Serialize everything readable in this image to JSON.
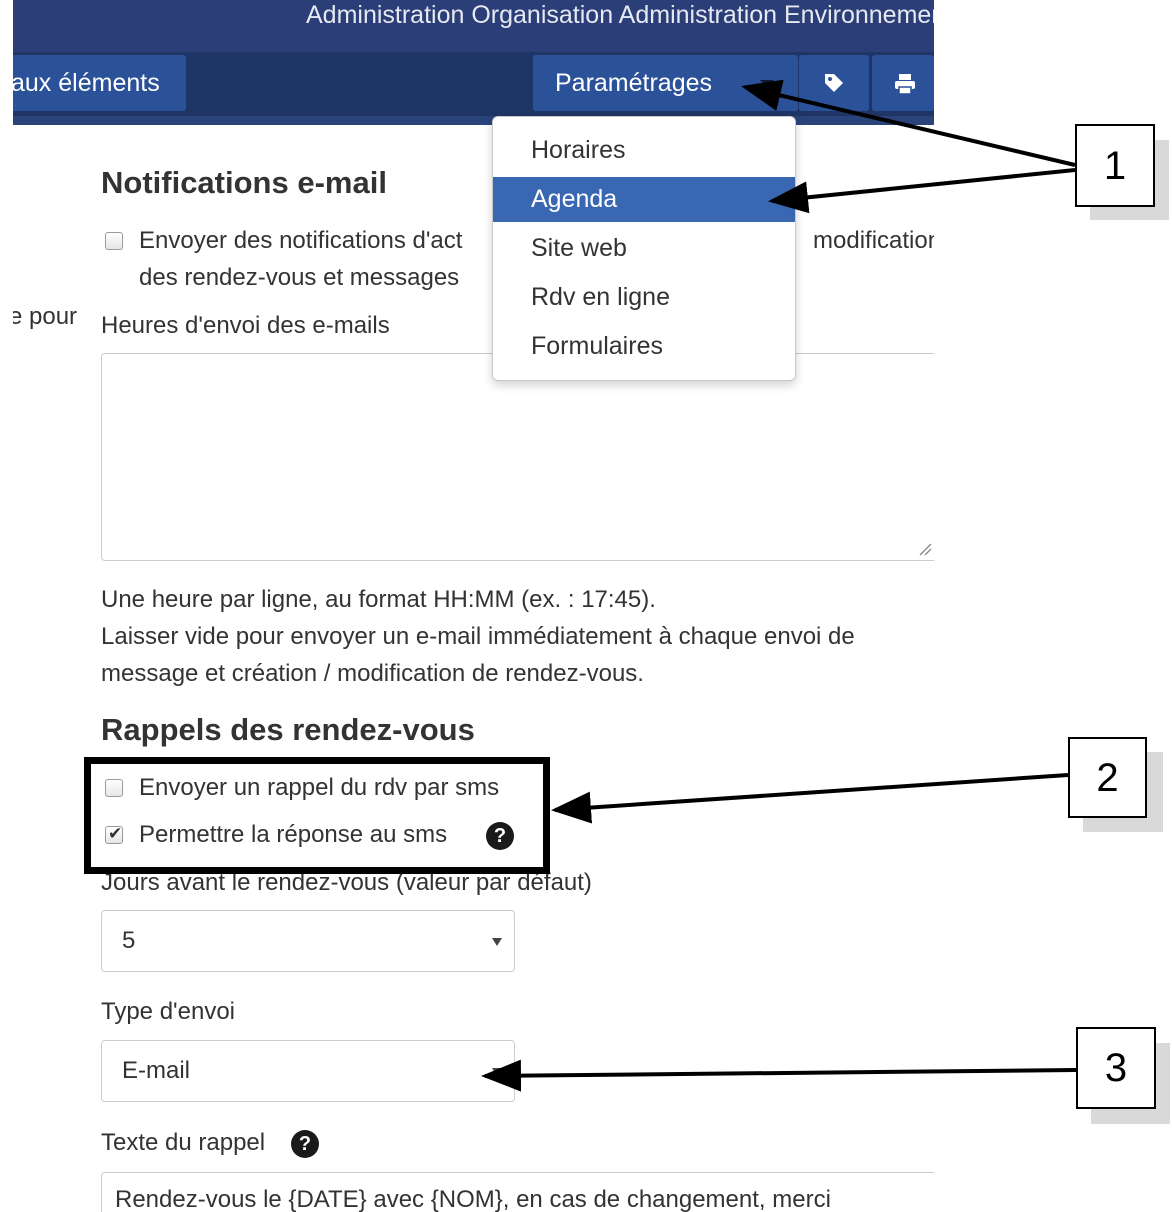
{
  "topnav": {
    "text": "Administration Organisation   Administration Environnement"
  },
  "toolbar": {
    "elements_label": "aux éléments",
    "settings_label": "Paramétrages"
  },
  "dropdown": {
    "items": [
      {
        "label": "Horaires",
        "active": false
      },
      {
        "label": "Agenda",
        "active": true
      },
      {
        "label": "Site web",
        "active": false
      },
      {
        "label": "Rdv en ligne",
        "active": false
      },
      {
        "label": "Formulaires",
        "active": false
      }
    ]
  },
  "email_notifications": {
    "title": "Notifications e-mail",
    "checkbox_line1_left": "Envoyer des notifications d'act",
    "checkbox_line1_right": "modification",
    "checkbox_line2": "des rendez-vous et messages",
    "left_fragment": "e pour",
    "hours_label": "Heures d'envoi des e-mails",
    "hours_value": "",
    "help_line1": "Une heure par ligne, au format HH:MM (ex. : 17:45).",
    "help_line2": "Laisser vide pour envoyer un e-mail immédiatement à chaque envoi de",
    "help_line3": "message et création / modification de rendez-vous."
  },
  "reminders": {
    "title": "Rappels des rendez-vous",
    "sms_reminder_label": "Envoyer un rappel du rdv par sms",
    "sms_reminder_checked": false,
    "sms_reply_label": "Permettre la réponse au sms",
    "sms_reply_checked": true,
    "days_label": "Jours avant le rendez-vous (valeur par défaut)",
    "days_value": "5",
    "type_label": "Type d'envoi",
    "type_value": "E-mail",
    "text_label": "Texte du rappel",
    "text_value": "Rendez-vous le {DATE} avec {NOM}, en cas de changement, merci"
  },
  "annotations": {
    "callout1": "1",
    "callout2": "2",
    "callout3": "3"
  },
  "icons": {
    "tag": "tag-icon",
    "print": "print-icon",
    "help": "question-icon"
  }
}
